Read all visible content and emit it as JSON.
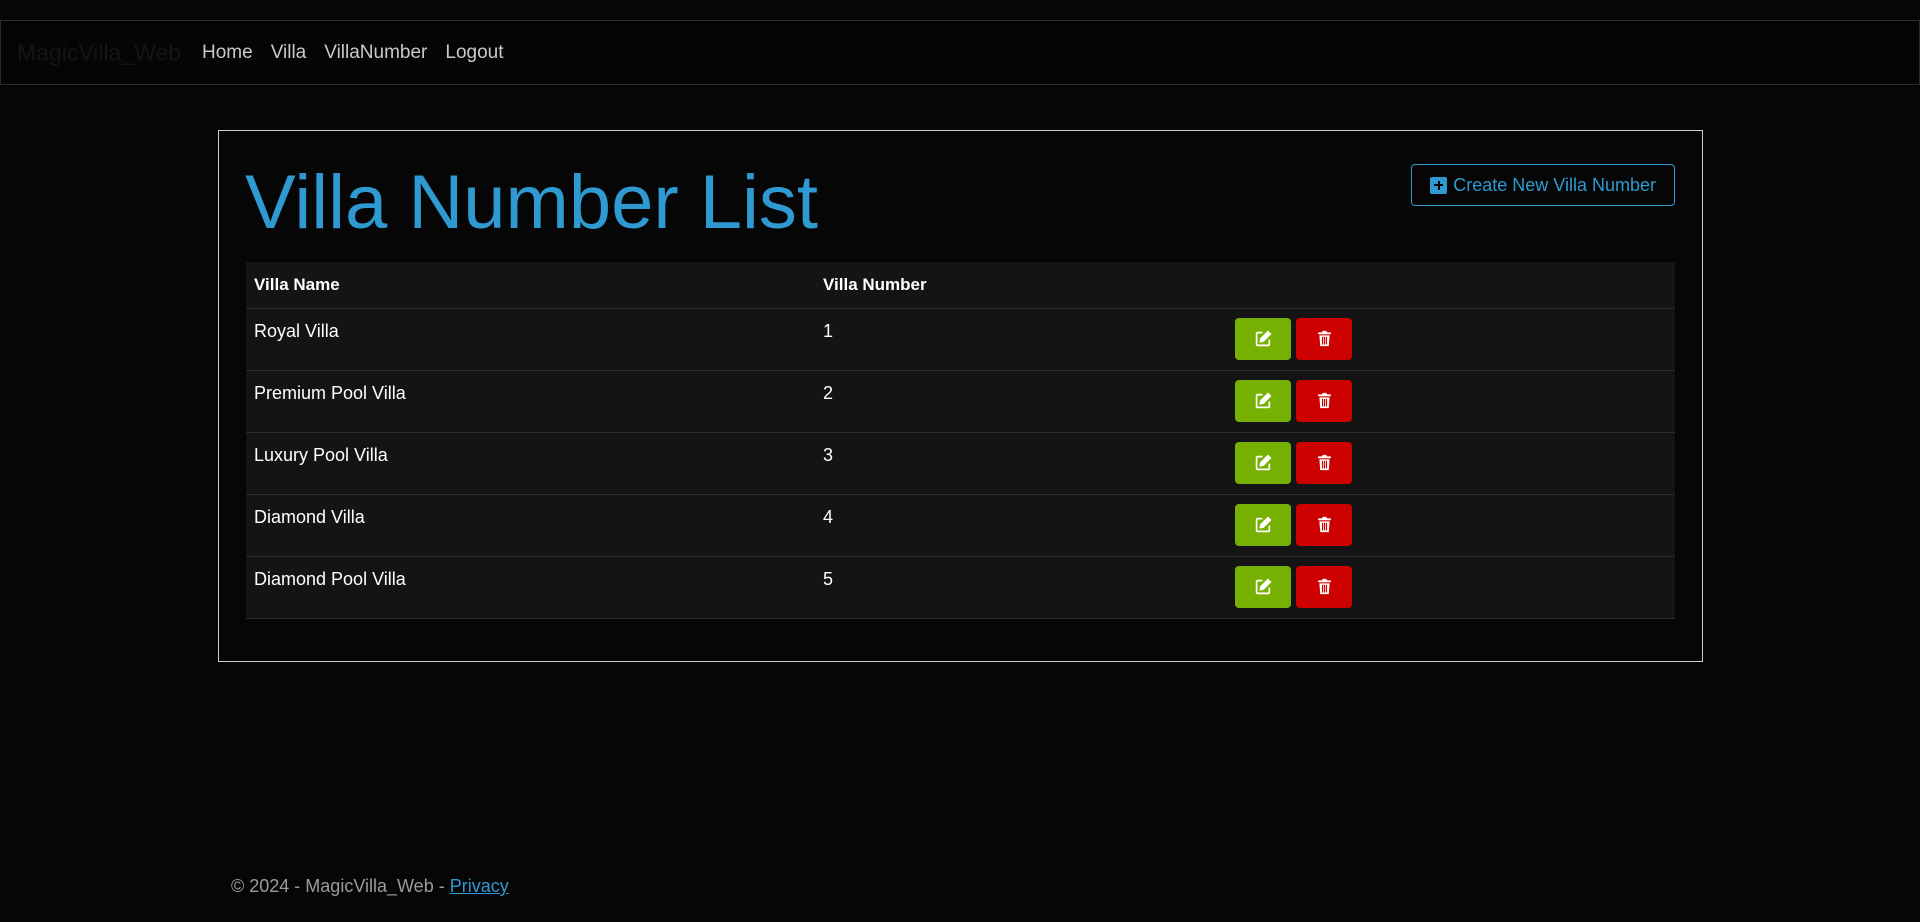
{
  "navbar": {
    "brand": "MagicVilla_Web",
    "links": [
      {
        "label": "Home"
      },
      {
        "label": "Villa"
      },
      {
        "label": "VillaNumber"
      },
      {
        "label": "Logout"
      }
    ]
  },
  "main": {
    "title": "Villa Number List",
    "create_button_label": "Create New Villa Number",
    "table": {
      "headers": [
        "Villa Name",
        "Villa Number",
        ""
      ],
      "rows": [
        {
          "villa_name": "Royal Villa",
          "villa_number": "1"
        },
        {
          "villa_name": "Premium Pool Villa",
          "villa_number": "2"
        },
        {
          "villa_name": "Luxury Pool Villa",
          "villa_number": "3"
        },
        {
          "villa_name": "Diamond Villa",
          "villa_number": "4"
        },
        {
          "villa_name": "Diamond Pool Villa",
          "villa_number": "5"
        }
      ]
    }
  },
  "footer": {
    "text": "© 2024 - MagicVilla_Web - ",
    "privacy_link": "Privacy"
  },
  "colors": {
    "accent": "#2e9ad1",
    "edit_button": "#76b003",
    "delete_button": "#cd0200",
    "background": "#060606"
  },
  "icons": {
    "create": "plus-square-icon",
    "edit": "pencil-square-icon",
    "delete": "trash-icon"
  }
}
